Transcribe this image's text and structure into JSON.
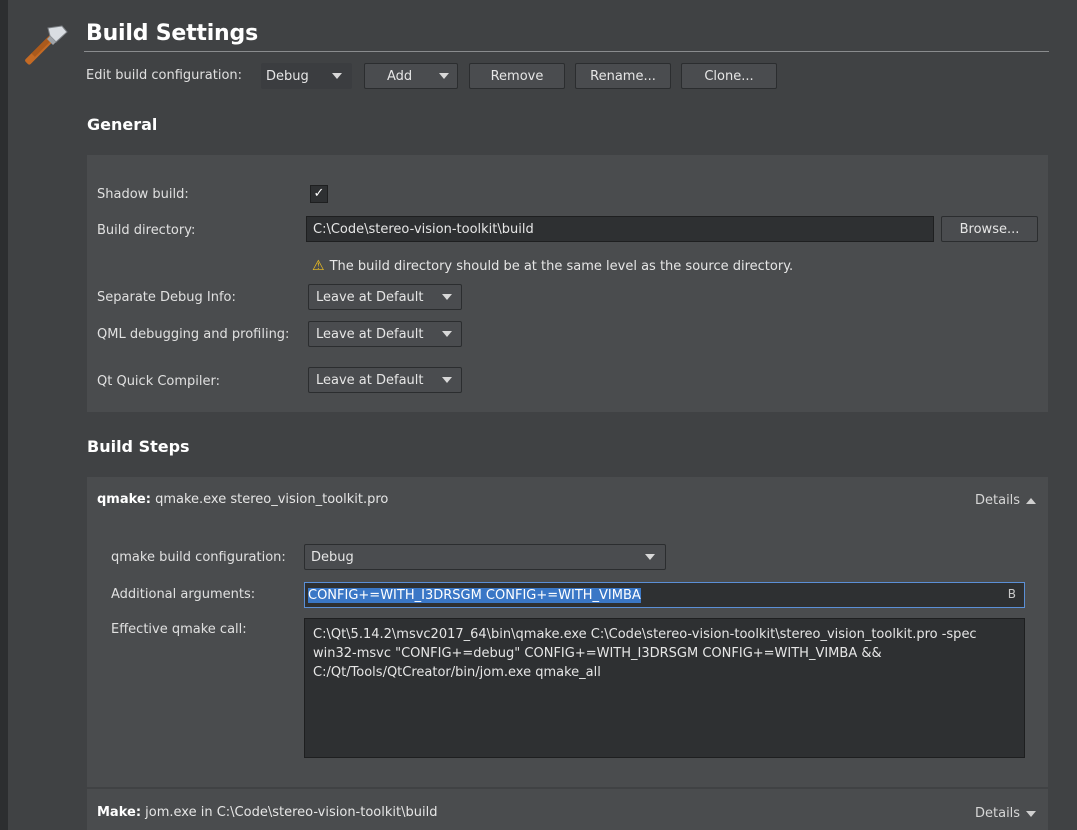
{
  "header": {
    "title": "Build Settings",
    "edit_config_label": "Edit build configuration:",
    "config_selected": "Debug",
    "add_label": "Add",
    "remove_label": "Remove",
    "rename_label": "Rename...",
    "clone_label": "Clone..."
  },
  "general": {
    "title": "General",
    "shadow_build_label": "Shadow build:",
    "shadow_build_checked": "✓",
    "build_dir_label": "Build directory:",
    "build_dir_value": "C:\\Code\\stereo-vision-toolkit\\build",
    "browse_label": "Browse...",
    "warning_icon": "⚠",
    "warning_text": "The build directory should be at the same level as the source directory.",
    "separate_debug_label": "Separate Debug Info:",
    "separate_debug_value": "Leave at Default",
    "qml_debug_label": "QML debugging and profiling:",
    "qml_debug_value": "Leave at Default",
    "qt_quick_label": "Qt Quick Compiler:",
    "qt_quick_value": "Leave at Default"
  },
  "build_steps": {
    "title": "Build Steps",
    "qmake": {
      "name": "qmake:",
      "summary": "qmake.exe stereo_vision_toolkit.pro",
      "details_label": "Details",
      "config_label": "qmake build configuration:",
      "config_value": "Debug",
      "args_label": "Additional arguments:",
      "args_value": "CONFIG+=WITH_I3DRSGM CONFIG+=WITH_VIMBA",
      "clear_icon_glyph": "ꓐ",
      "effective_label": "Effective qmake call:",
      "effective_value": "C:\\Qt\\5.14.2\\msvc2017_64\\bin\\qmake.exe C:\\Code\\stereo-vision-toolkit\\stereo_vision_toolkit.pro -spec win32-msvc \"CONFIG+=debug\" CONFIG+=WITH_I3DRSGM CONFIG+=WITH_VIMBA && C:/Qt/Tools/QtCreator/bin/jom.exe qmake_all"
    },
    "make": {
      "name": "Make:",
      "summary": "jom.exe in C:\\Code\\stereo-vision-toolkit\\build",
      "details_label": "Details"
    }
  },
  "colors": {
    "background": "#404244",
    "panel": "#4a4c4e",
    "field": "#2e3032",
    "selection": "#3a77c6",
    "warning": "#f0c020"
  }
}
